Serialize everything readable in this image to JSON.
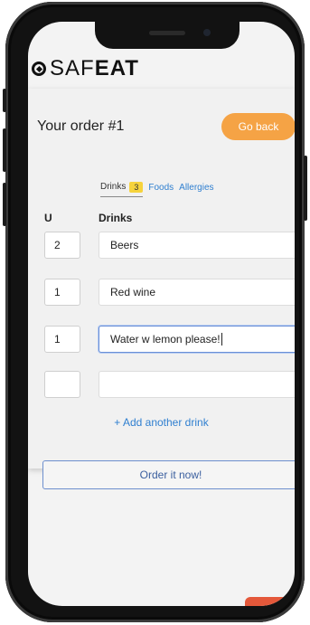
{
  "app": {
    "logo_prefix": "SAF",
    "logo_bold": "EAT"
  },
  "order": {
    "title": "Your order #1",
    "back_label": "Go back"
  },
  "tabs": [
    {
      "label": "Drinks",
      "badge": "3"
    },
    {
      "label": "Foods"
    },
    {
      "label": "Allergies"
    }
  ],
  "columns": {
    "qty": "U",
    "drinks": "Drinks"
  },
  "rows": [
    {
      "qty": "2",
      "drink": "Beers"
    },
    {
      "qty": "1",
      "drink": "Red wine"
    },
    {
      "qty": "1",
      "drink": "Water w lemon please!"
    },
    {
      "qty": "",
      "drink": ""
    }
  ],
  "add_drink_label": "+ Add another drink",
  "order_button_label": "Order it now!",
  "colors": {
    "accent_orange": "#f5a345",
    "link_blue": "#2f7fd0",
    "badge_yellow": "#f6d33c",
    "button_border": "#6d8fce"
  }
}
